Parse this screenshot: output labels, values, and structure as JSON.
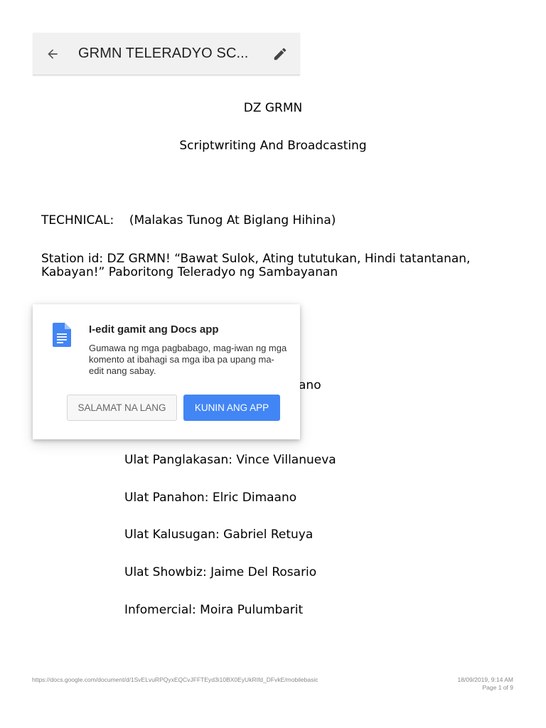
{
  "app_bar": {
    "title": "GRMN TELERADYO SC...",
    "back_icon": "arrow-back-icon",
    "edit_icon": "pencil-icon"
  },
  "document": {
    "heading": "DZ GRMN",
    "subheading": "Scriptwriting And Broadcasting",
    "technical": "TECHNICAL:    (Malakas Tunog At Biglang Hihina)",
    "station_id": "Station id: DZ GRMN! “Bawat Sulok, Ating tututukan, Hindi tatantanan, Kabayan!” Paboritong Teleradyo ng Sambayanan",
    "partial_fragment": "ano",
    "roster": [
      "Ulat Panglakasan: Vince Villanueva",
      "Ulat Panahon: Elric Dimaano",
      "Ulat Kalusugan: Gabriel Retuya",
      "Ulat Showbiz: Jaime Del Rosario",
      "Infomercial: Moira Pulumbarit"
    ]
  },
  "popup": {
    "icon": "google-docs-icon",
    "title": "I-edit gamit ang Docs app",
    "body": "Gumawa ng mga pagbabago, mag-iwan ng mga komento at ibahagi sa mga iba pa upang ma-edit nang sabay.",
    "dismiss_label": "SALAMAT NA LANG",
    "get_app_label": "KUNIN ANG APP"
  },
  "footer": {
    "url": "https://docs.google.com/document/d/1SvELvuRPQyxEQCvJFFTEyd3i10BX0EyUkRIfd_DFvkE/mobilebasic",
    "datetime": "18/09/2019, 9:14 AM",
    "page": "Page 1 of 9"
  },
  "colors": {
    "primary_button": "#4285f4",
    "app_bar_bg": "#f1f1f1",
    "docs_icon": "#4285f4"
  }
}
